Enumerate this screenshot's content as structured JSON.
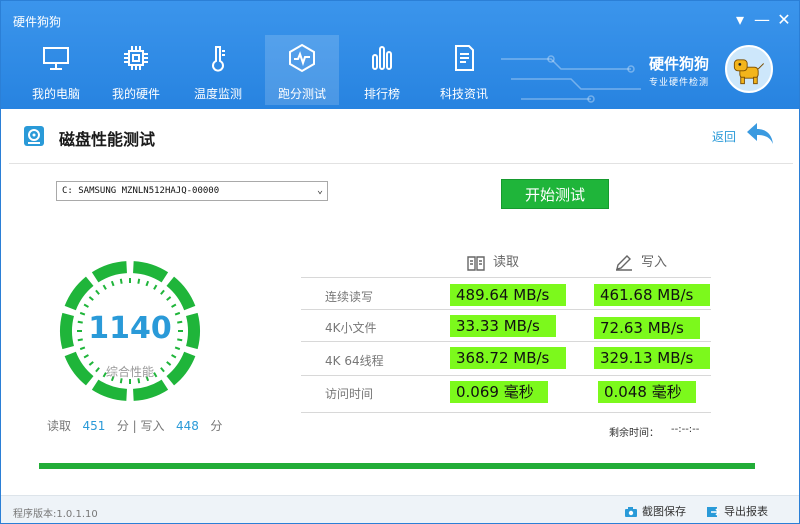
{
  "window": {
    "title": "硬件狗狗",
    "controls": {
      "menu": "▾",
      "minimize": "—",
      "close": "✕"
    }
  },
  "nav": {
    "tabs": [
      {
        "label": "我的电脑",
        "icon": "monitor-icon"
      },
      {
        "label": "我的硬件",
        "icon": "chip-icon"
      },
      {
        "label": "温度监测",
        "icon": "thermometer-icon"
      },
      {
        "label": "跑分测试",
        "icon": "benchmark-icon",
        "active": true
      },
      {
        "label": "排行榜",
        "icon": "ranking-icon"
      },
      {
        "label": "科技资讯",
        "icon": "news-icon"
      }
    ]
  },
  "brand": {
    "name": "硬件狗狗",
    "tagline": "专业硬件检测",
    "mascot": "dog-mascot-icon"
  },
  "section": {
    "title": "磁盘性能测试",
    "back_label": "返回"
  },
  "drive": {
    "selected": "C: SAMSUNG MZNLN512HAJQ-00000"
  },
  "start_button": "开始测试",
  "score": {
    "value": "1140",
    "label": "综合性能",
    "summary": {
      "read_label": "读取",
      "read_value": "451",
      "unit": "分",
      "separator": "|",
      "write_label": "写入",
      "write_value": "448"
    }
  },
  "results": {
    "read_header": "读取",
    "write_header": "写入",
    "rows": [
      {
        "label": "连续读写",
        "read": "489.64 MB/s",
        "write": "461.68 MB/s"
      },
      {
        "label": "4K小文件",
        "read": "33.33 MB/s",
        "write": "72.63 MB/s"
      },
      {
        "label": "4K 64线程",
        "read": "368.72 MB/s",
        "write": "329.13 MB/s"
      },
      {
        "label": "访问时间",
        "read": "0.069 毫秒",
        "write": "0.048 毫秒"
      }
    ]
  },
  "remaining": {
    "label": "剩余时间：",
    "value": "--:--:--"
  },
  "progress": {
    "percent": 100
  },
  "footer": {
    "version": "程序版本:1.0.1.10",
    "screenshot": "截图保存",
    "export": "导出报表"
  },
  "colors": {
    "header": "#2783e0",
    "accent": "#2a9ad8",
    "green": "#1fb53a",
    "highlight": "#7cf91c"
  }
}
